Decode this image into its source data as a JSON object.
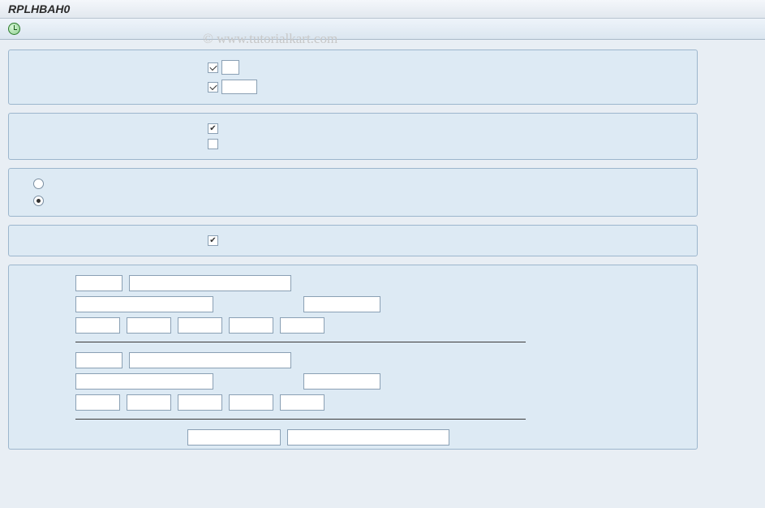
{
  "title": "RPLHBAH0",
  "watermark": "© www.tutorialkart.com",
  "toolbar": {
    "execute_icon": "clock-icon"
  },
  "panels": {
    "panel1": {
      "check1": {
        "checked": true,
        "box": "narrow"
      },
      "check2": {
        "checked": true,
        "box": "wide"
      }
    },
    "panel2": {
      "check1": {
        "checked": true
      },
      "check2": {
        "checked": false
      }
    },
    "panel3": {
      "radio1": {
        "checked": false
      },
      "radio2": {
        "checked": true
      }
    },
    "panel4": {
      "check1": {
        "checked": true
      }
    },
    "panel5": {
      "group1": {
        "row1": {
          "f1_w": 58,
          "f2_w": 200
        },
        "row2": {
          "f1_w": 170,
          "gap": 95,
          "f2_w": 95
        },
        "row3": {
          "f1_w": 55,
          "f2_w": 55,
          "f3_w": 55,
          "f4_w": 55,
          "f5_w": 55
        }
      },
      "group2": {
        "row1": {
          "f1_w": 58,
          "f2_w": 200
        },
        "row2": {
          "f1_w": 170,
          "gap": 95,
          "f2_w": 95
        },
        "row3": {
          "f1_w": 55,
          "f2_w": 55,
          "f3_w": 55,
          "f4_w": 55,
          "f5_w": 55
        }
      },
      "group3": {
        "row1": {
          "f1_w": 115,
          "f2_w": 200
        }
      }
    }
  }
}
